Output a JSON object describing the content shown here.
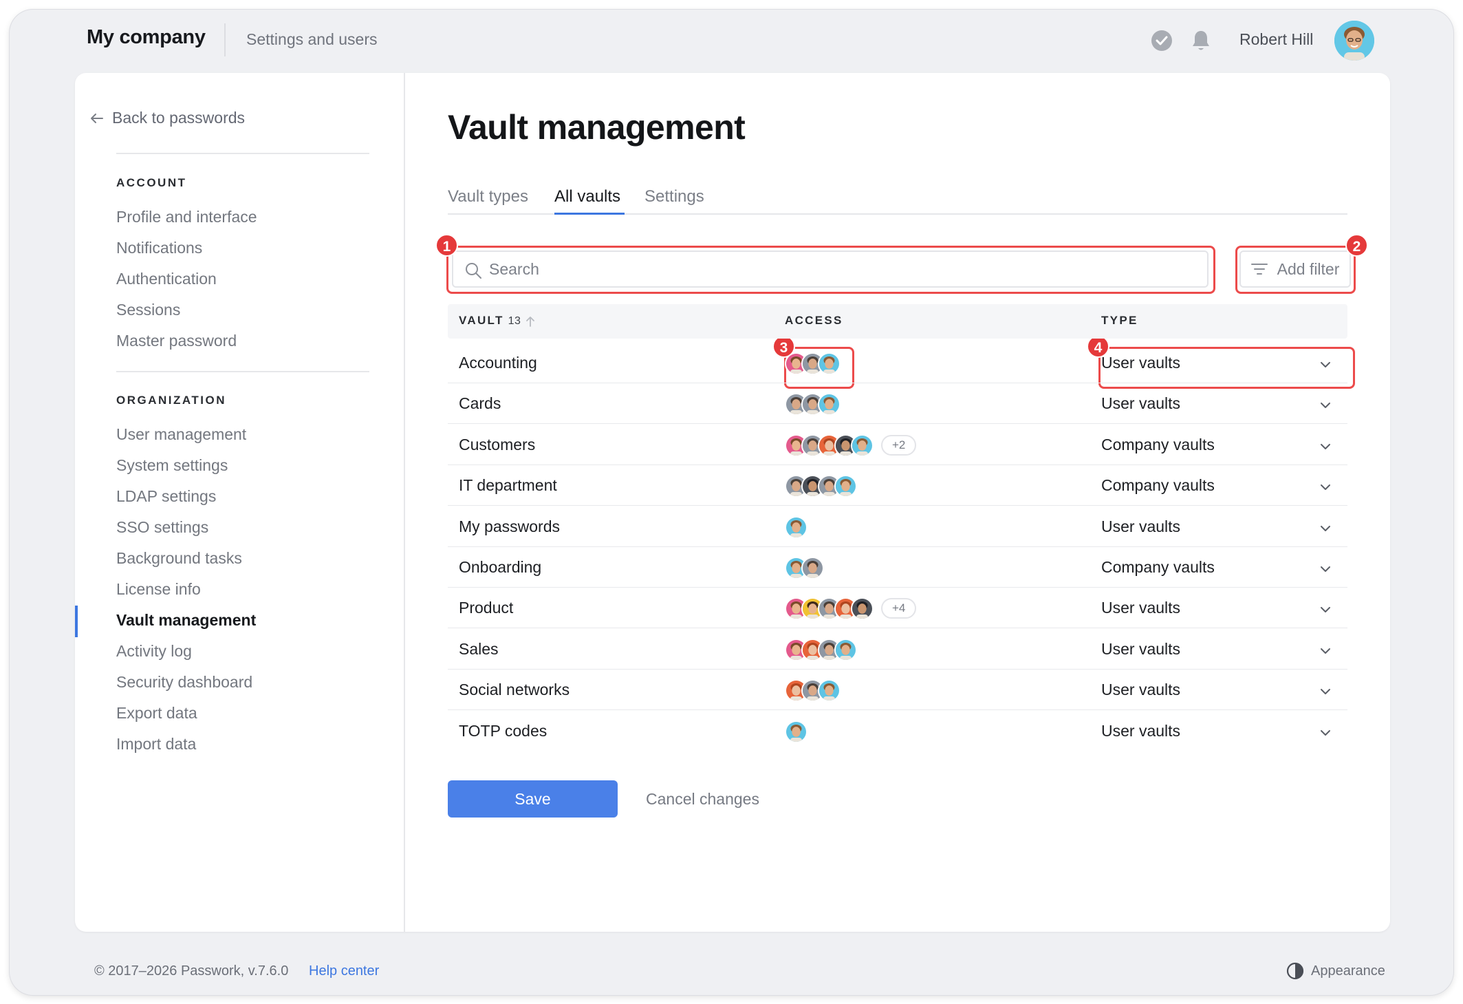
{
  "header": {
    "company": "My company",
    "subtitle": "Settings and users",
    "user_name": "Robert Hill"
  },
  "sidebar": {
    "back_label": "Back to passwords",
    "account_title": "ACCOUNT",
    "account_items": [
      "Profile and interface",
      "Notifications",
      "Authentication",
      "Sessions",
      "Master password"
    ],
    "org_title": "ORGANIZATION",
    "org_items": [
      "User management",
      "System settings",
      "LDAP settings",
      "SSO settings",
      "Background tasks",
      "License info",
      "Vault management",
      "Activity log",
      "Security dashboard",
      "Export data",
      "Import data"
    ],
    "active_item": "Vault management"
  },
  "main": {
    "title": "Vault management",
    "tabs": [
      "Vault types",
      "All vaults",
      "Settings"
    ],
    "active_tab": "All vaults",
    "search_placeholder": "Search",
    "filter_label": "Add filter",
    "markers": [
      "1",
      "2",
      "3",
      "4"
    ]
  },
  "table": {
    "col_vault": "VAULT",
    "vault_count": "13",
    "col_access": "ACCESS",
    "col_type": "TYPE",
    "rows": [
      {
        "name": "Accounting",
        "avatars": [
          "pink",
          "gray",
          "teal"
        ],
        "extra": "",
        "type": "User vaults"
      },
      {
        "name": "Cards",
        "avatars": [
          "gray",
          "red",
          "teal"
        ],
        "extra": "",
        "type": "User vaults"
      },
      {
        "name": "Customers",
        "avatars": [
          "pink",
          "gray",
          "orange",
          "dark",
          "teal"
        ],
        "extra": "+2",
        "type": "Company vaults"
      },
      {
        "name": "IT department",
        "avatars": [
          "gray",
          "dark",
          "gray",
          "teal"
        ],
        "extra": "",
        "type": "Company vaults"
      },
      {
        "name": "My passwords",
        "avatars": [
          "teal"
        ],
        "extra": "",
        "type": "User vaults"
      },
      {
        "name": "Onboarding",
        "avatars": [
          "teal",
          "gray"
        ],
        "extra": "",
        "type": "Company vaults"
      },
      {
        "name": "Product",
        "avatars": [
          "pink",
          "yellow",
          "gray",
          "orange",
          "dark"
        ],
        "extra": "+4",
        "type": "User vaults"
      },
      {
        "name": "Sales",
        "avatars": [
          "pink",
          "orange",
          "gray",
          "teal"
        ],
        "extra": "",
        "type": "User vaults"
      },
      {
        "name": "Social networks",
        "avatars": [
          "orange",
          "gray",
          "teal"
        ],
        "extra": "",
        "type": "User vaults"
      },
      {
        "name": "TOTP codes",
        "avatars": [
          "teal"
        ],
        "extra": "",
        "type": "User vaults"
      }
    ]
  },
  "actions": {
    "save": "Save",
    "cancel": "Cancel changes"
  },
  "footer": {
    "copyright": "© 2017–2026 Passwork, v.7.6.0",
    "help": "Help center",
    "appearance": "Appearance"
  },
  "colors": {
    "accent": "#3d77e0",
    "save_button": "#4a80e8",
    "highlight": "#ec4b4b",
    "marker": "#e5393a"
  },
  "icons": [
    "check-icon",
    "bell-icon",
    "arrow-left-icon",
    "search-icon",
    "filter-icon",
    "sort-up-icon",
    "chevron-down-icon",
    "contrast-icon"
  ]
}
